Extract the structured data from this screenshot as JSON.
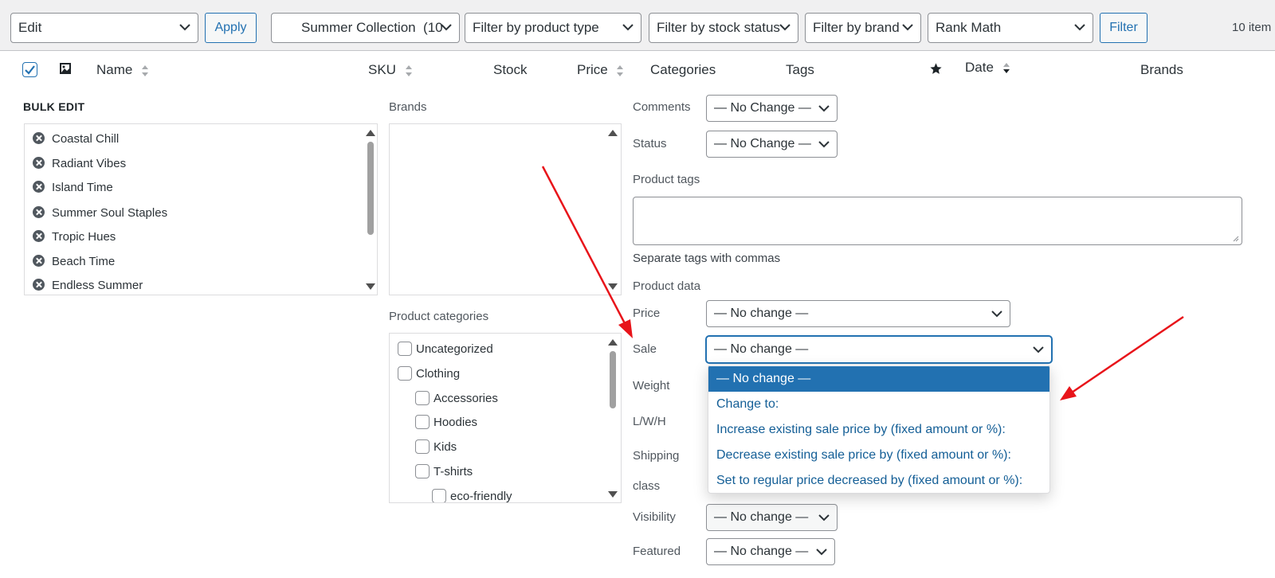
{
  "toolbar": {
    "bulk_action": "Edit",
    "apply_label": "Apply",
    "collection_filter": "Summer Collection  (10",
    "product_type_filter": "Filter by product type",
    "stock_status_filter": "Filter by stock status",
    "brand_filter": "Filter by brand",
    "seo_filter": "Rank Math",
    "filter_label": "Filter",
    "items_count": "10 item"
  },
  "table_header": {
    "name": "Name",
    "sku": "SKU",
    "stock": "Stock",
    "price": "Price",
    "categories": "Categories",
    "tags": "Tags",
    "date": "Date",
    "brands": "Brands"
  },
  "bulk_edit": {
    "title": "BULK EDIT",
    "products": [
      "Coastal Chill",
      "Radiant Vibes",
      "Island Time",
      "Summer Soul Staples",
      "Tropic Hues",
      "Beach Time",
      "Endless Summer"
    ],
    "brands_label": "Brands",
    "categories_label": "Product categories",
    "categories": [
      {
        "label": "Uncategorized",
        "level": 0
      },
      {
        "label": "Clothing",
        "level": 0
      },
      {
        "label": "Accessories",
        "level": 1
      },
      {
        "label": "Hoodies",
        "level": 1
      },
      {
        "label": "Kids",
        "level": 1
      },
      {
        "label": "T-shirts",
        "level": 1
      },
      {
        "label": "eco-friendly",
        "level": 2
      }
    ]
  },
  "fields": {
    "comments_label": "Comments",
    "comments_value": "— No Change —",
    "status_label": "Status",
    "status_value": "— No Change —",
    "tags_label": "Product tags",
    "tags_hint": "Separate tags with commas",
    "product_data_label": "Product data",
    "price_label": "Price",
    "price_value": "— No change —",
    "sale_label": "Sale",
    "sale_value": "— No change —",
    "weight_label": "Weight",
    "lwh_label": "L/W/H",
    "shipping_label": "Shipping",
    "class_label": "class",
    "visibility_label": "Visibility",
    "visibility_value": "— No change —",
    "featured_label": "Featured",
    "featured_value": "— No change —"
  },
  "sale_dropdown": {
    "options": [
      "— No change —",
      "Change to:",
      "Increase existing sale price by (fixed amount or %):",
      "Decrease existing sale price by (fixed amount or %):",
      "Set to regular price decreased by (fixed amount or %):"
    ],
    "selected_index": 0
  },
  "colors": {
    "accent": "#2271b1",
    "annotation_arrow": "#e8141a"
  }
}
